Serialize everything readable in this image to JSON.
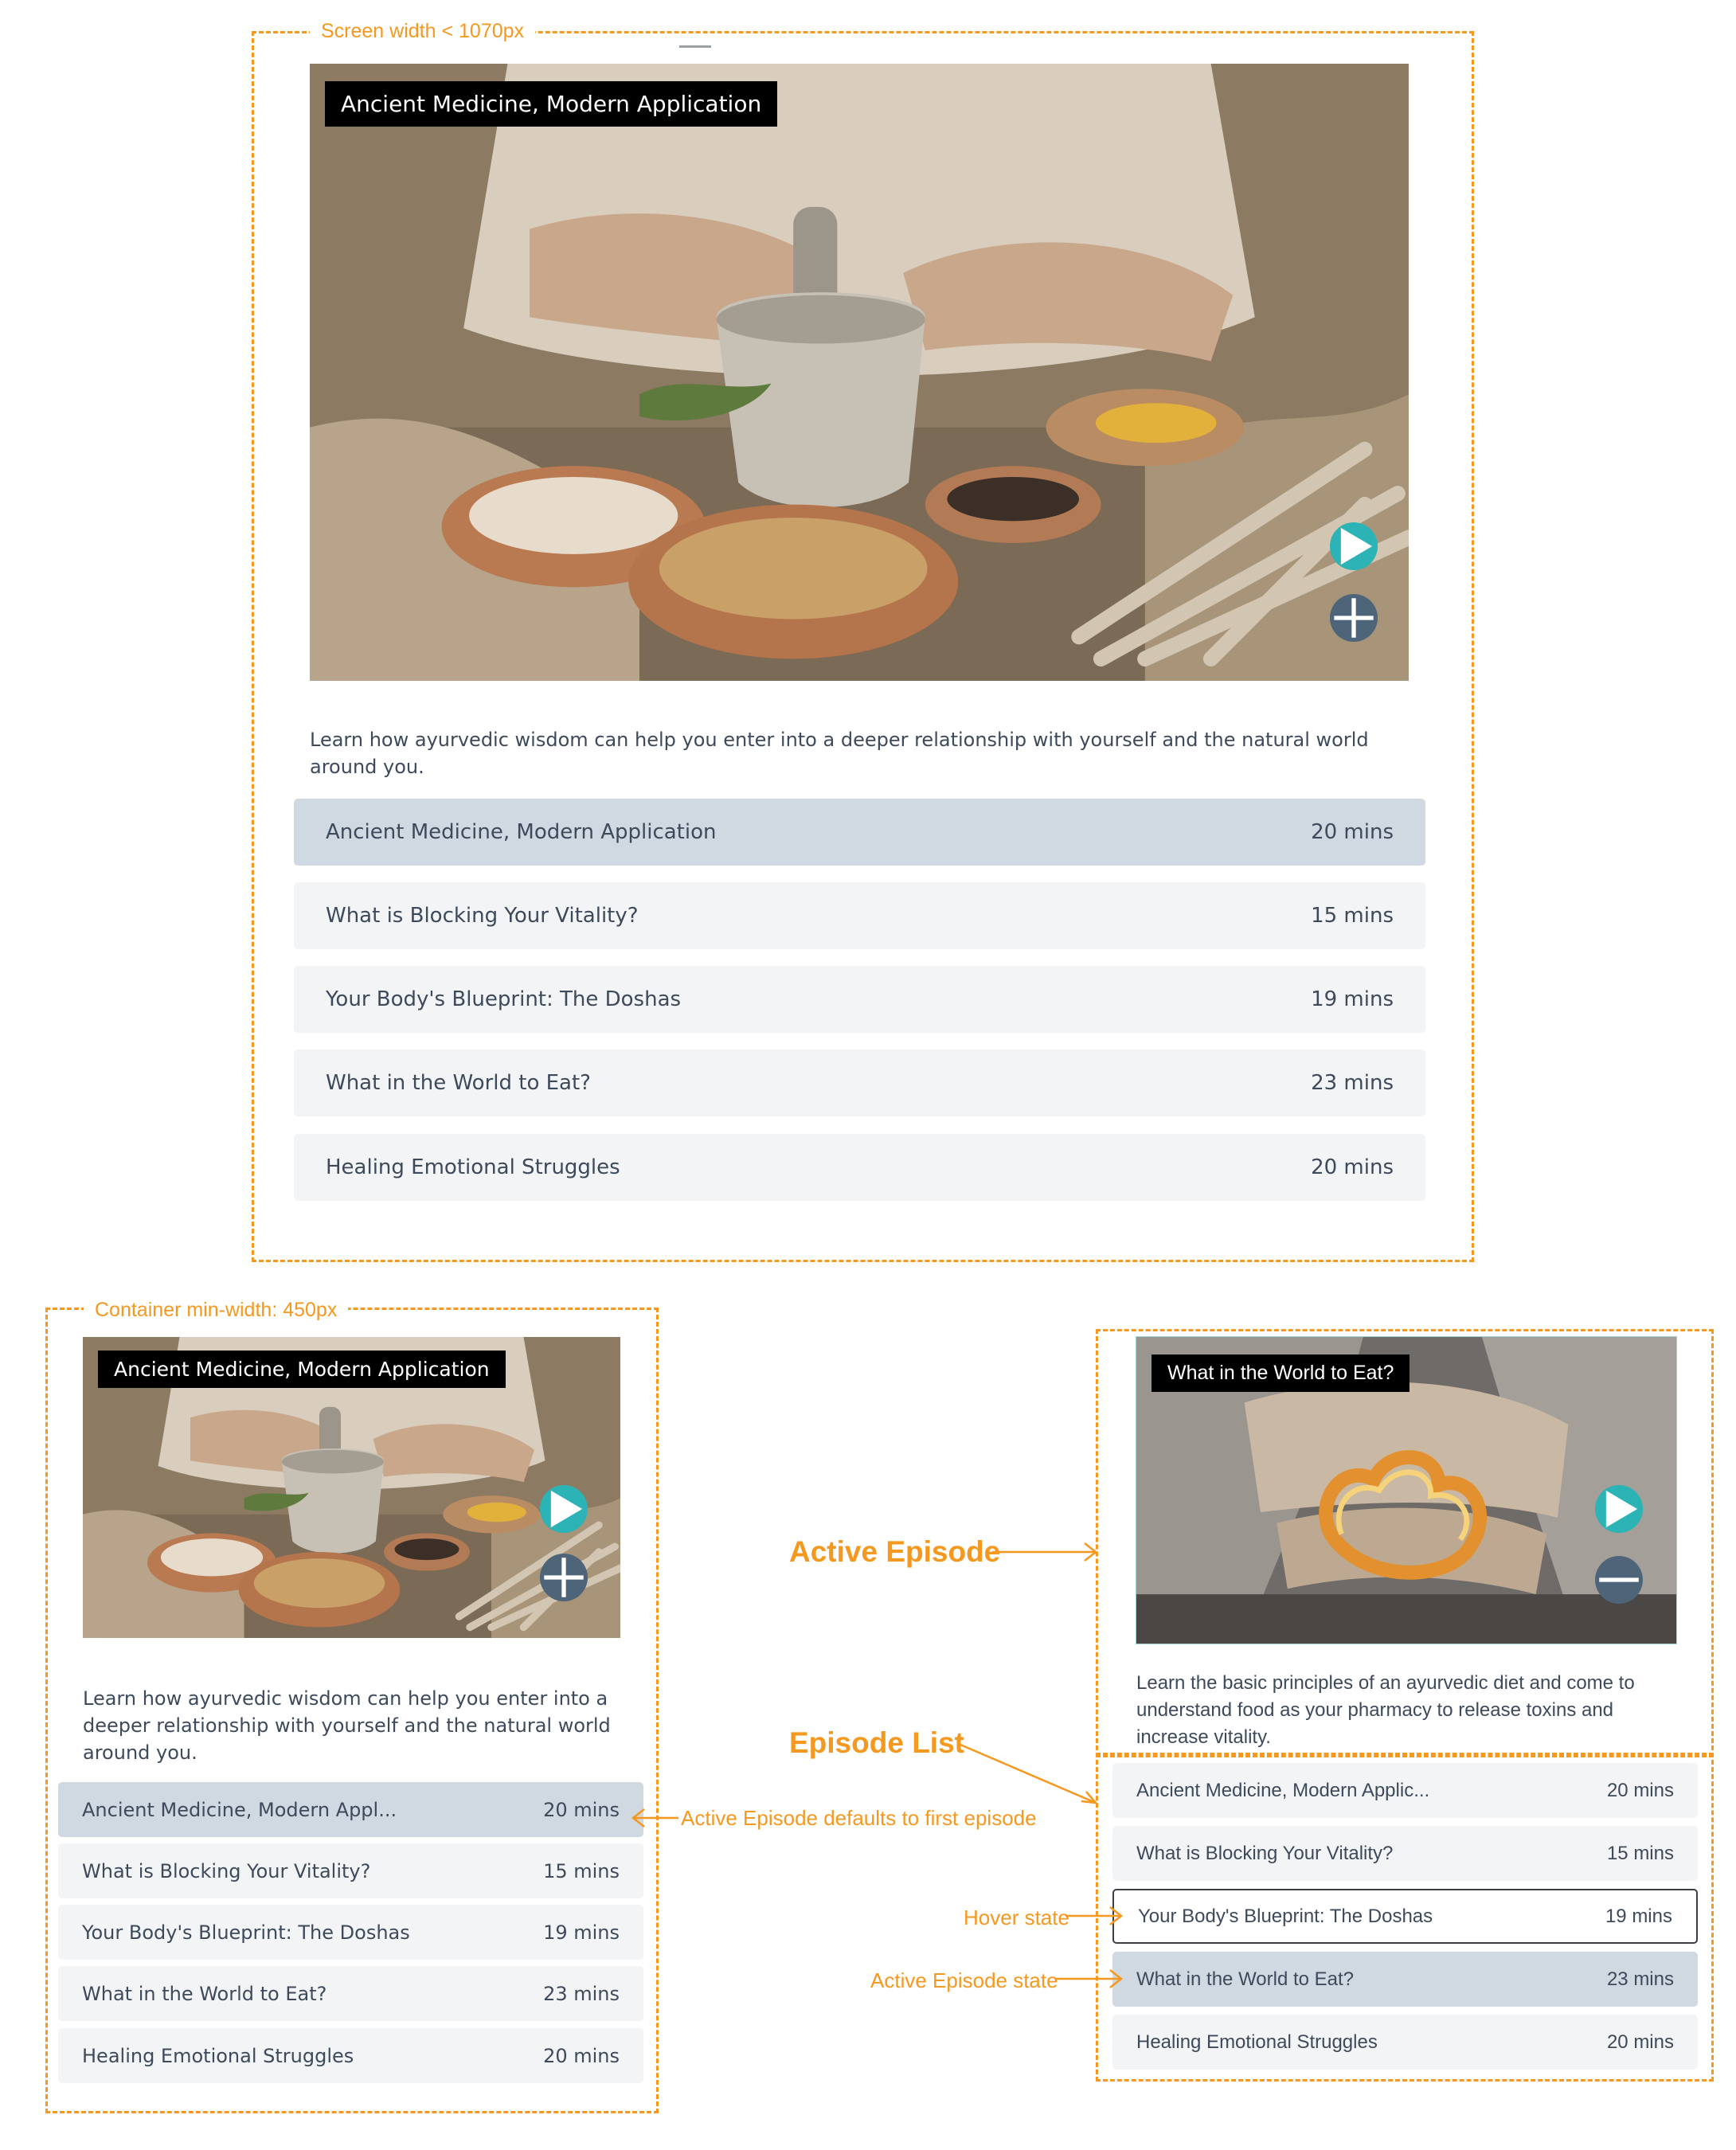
{
  "annotations": {
    "screen_width": "Screen width < 1070px",
    "container_min_width": "Container min-width: 450px",
    "active_episode": "Active Episode",
    "episode_list": "Episode List",
    "active_default": "Active Episode defaults to first episode",
    "hover_state": "Hover state",
    "active_state": "Active Episode state"
  },
  "colors": {
    "annotation": "#f5981f",
    "play_button": "#2bb3b5",
    "add_button": "#4e6479",
    "active_row": "#d0d8e1",
    "row": "#f3f4f5",
    "text": "#3d4a5c"
  },
  "icons": {
    "play": "play-icon",
    "add": "plus-icon",
    "remove": "minus-icon"
  },
  "large_view": {
    "hero_title": "Ancient Medicine, Modern Application",
    "description": "Learn how ayurvedic wisdom can help you enter into a deeper relationship with yourself and the natural world around you.",
    "episodes": [
      {
        "title": "Ancient Medicine, Modern Application",
        "duration": "20 mins",
        "state": "active"
      },
      {
        "title": "What is Blocking Your Vitality?",
        "duration": "15 mins",
        "state": "default"
      },
      {
        "title": "Your Body's Blueprint: The Doshas",
        "duration": "19 mins",
        "state": "default"
      },
      {
        "title": "What in the World to Eat?",
        "duration": "23 mins",
        "state": "default"
      },
      {
        "title": "Healing Emotional Struggles",
        "duration": "20 mins",
        "state": "default"
      }
    ]
  },
  "small_view": {
    "hero_title": "Ancient Medicine, Modern Application",
    "description": "Learn how ayurvedic wisdom can help you enter into a deeper relationship with yourself and the natural world around you.",
    "episodes": [
      {
        "title": "Ancient Medicine, Modern Appl...",
        "duration": "20 mins",
        "state": "active"
      },
      {
        "title": "What is Blocking Your Vitality?",
        "duration": "15 mins",
        "state": "default"
      },
      {
        "title": "Your Body's Blueprint: The Doshas",
        "duration": "19 mins",
        "state": "default"
      },
      {
        "title": "What in the World to Eat?",
        "duration": "23 mins",
        "state": "default"
      },
      {
        "title": "Healing Emotional Struggles",
        "duration": "20 mins",
        "state": "default"
      }
    ]
  },
  "active_view": {
    "hero_title": "What in the World to Eat?",
    "description": "Learn the basic principles of an ayurvedic diet and come to understand food as your pharmacy to release toxins and increase vitality.",
    "episodes": [
      {
        "title": "Ancient Medicine, Modern Applic...",
        "duration": "20 mins",
        "state": "default"
      },
      {
        "title": "What is Blocking Your Vitality?",
        "duration": "15 mins",
        "state": "default"
      },
      {
        "title": "Your Body's Blueprint: The Doshas",
        "duration": "19 mins",
        "state": "hover"
      },
      {
        "title": "What in the World to Eat?",
        "duration": "23 mins",
        "state": "active"
      },
      {
        "title": "Healing Emotional Struggles",
        "duration": "20 mins",
        "state": "default"
      }
    ]
  }
}
